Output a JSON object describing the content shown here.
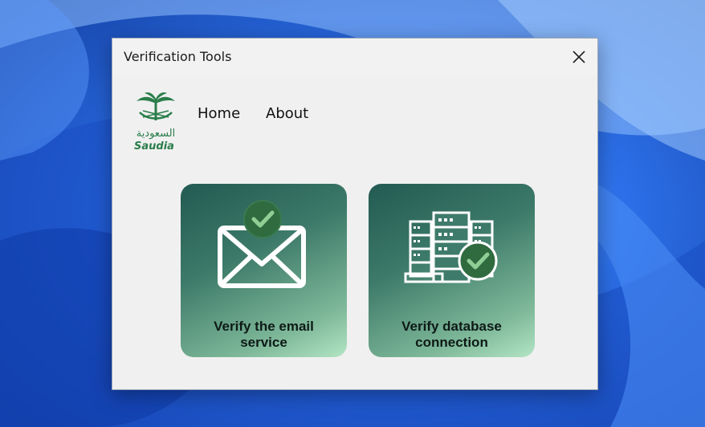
{
  "window": {
    "title": "Verification Tools"
  },
  "logo": {
    "arabic": "السعودية",
    "latin": "Saudia",
    "color": "#2a7d4b"
  },
  "nav": {
    "home": "Home",
    "about": "About"
  },
  "tiles": [
    {
      "label": "Verify the email\nservice",
      "icon": "email-check-icon"
    },
    {
      "label": "Verify database\nconnection",
      "icon": "database-server-check-icon"
    }
  ],
  "colors": {
    "accent": "#2f6b3f",
    "tile_start": "#225a52",
    "tile_end": "#b2e5c4"
  }
}
